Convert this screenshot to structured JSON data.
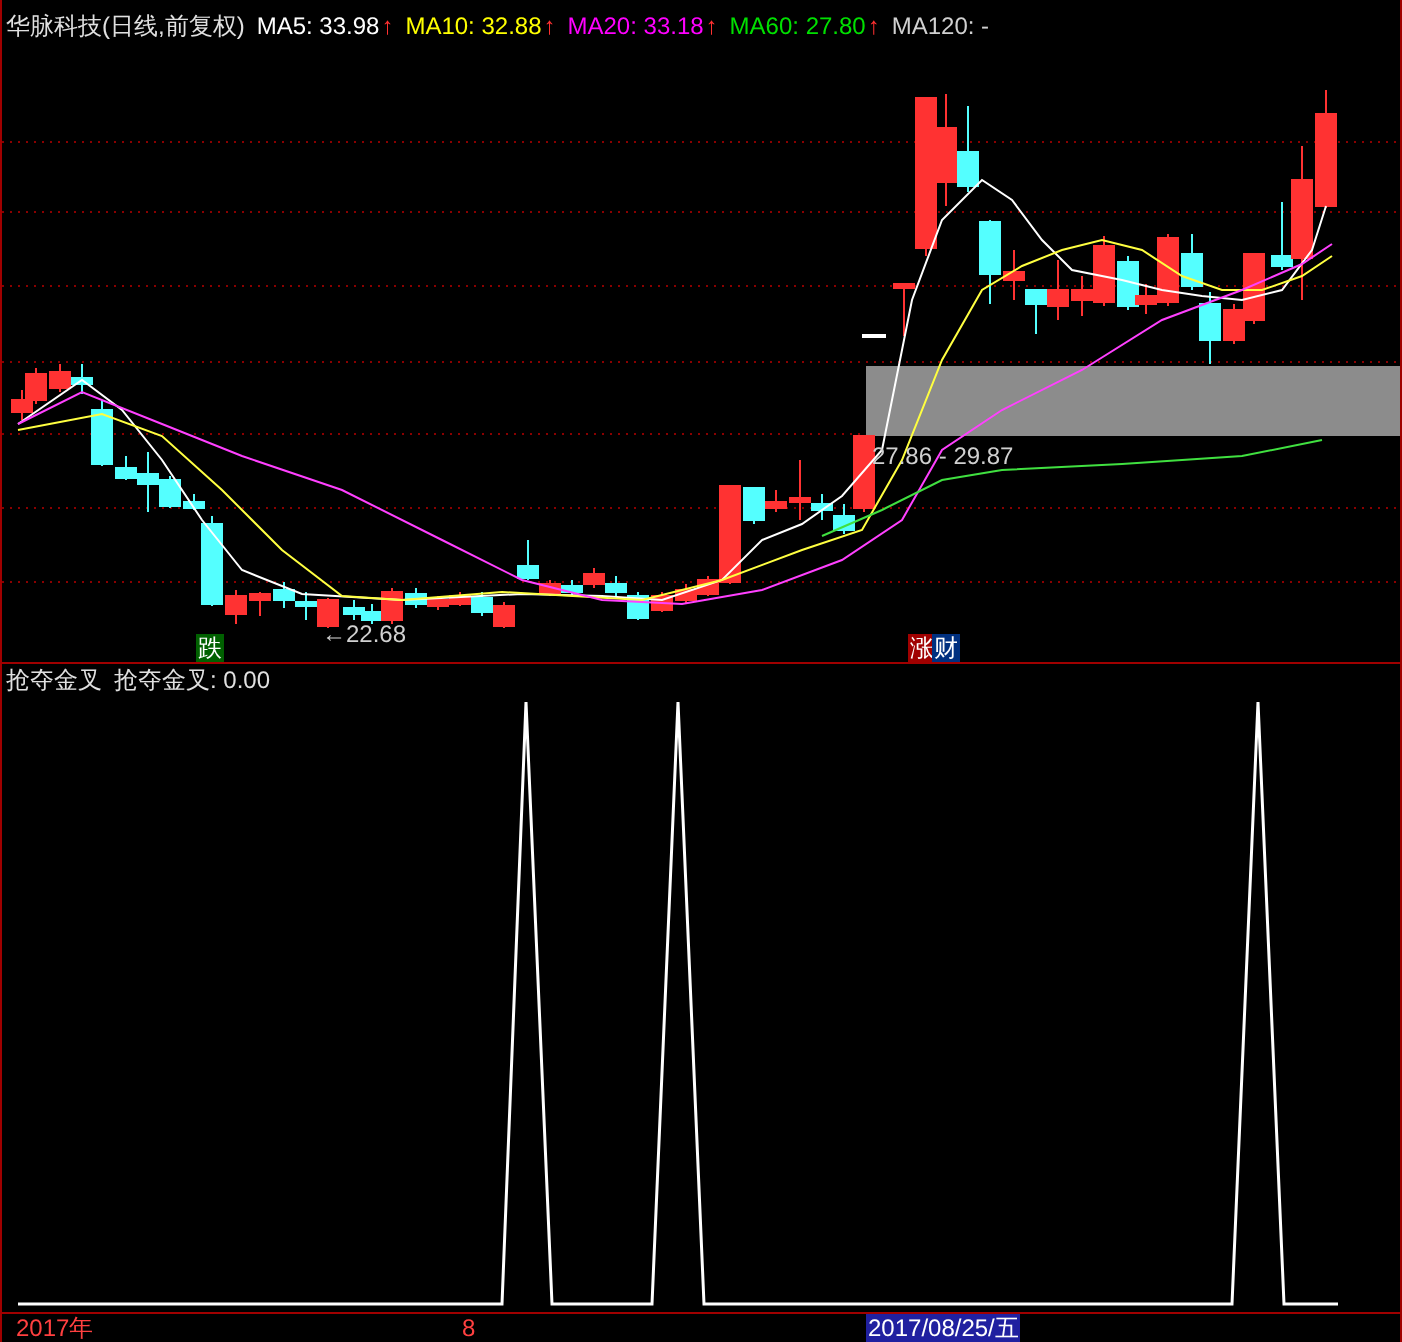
{
  "header": {
    "title": "华脉科技(日线,前复权)",
    "averages": [
      {
        "label": "MA5: 33.98",
        "arrow": "↑",
        "color": "#ffffff"
      },
      {
        "label": "MA10: 32.88",
        "arrow": "↑",
        "color": "#ffff00"
      },
      {
        "label": "MA20: 33.18",
        "arrow": "↑",
        "color": "#ff00ff"
      },
      {
        "label": "MA60: 27.80",
        "arrow": "↑",
        "color": "#00e000"
      },
      {
        "label": "MA120: -",
        "color": "#d0d0d0"
      }
    ]
  },
  "price_chart": {
    "signals": [
      {
        "text": "跌",
        "kind": "fall"
      },
      {
        "text": "涨",
        "kind": "rise"
      },
      {
        "text": "财",
        "kind": "wealth"
      }
    ],
    "annotations": [
      {
        "text": "←22.68"
      },
      {
        "text": "27.86 - 29.87"
      }
    ]
  },
  "indicator": {
    "name": "抢夺金叉",
    "reading": "抢夺金叉: 0.00"
  },
  "axis": [
    {
      "text": "2017年",
      "selected": false
    },
    {
      "text": "8",
      "selected": false
    },
    {
      "text": "2017/08/25/五",
      "selected": true
    }
  ]
}
